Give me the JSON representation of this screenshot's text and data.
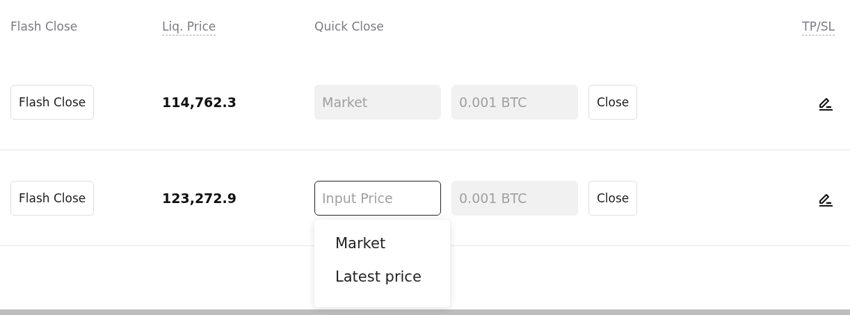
{
  "columns": [
    {
      "label": "Flash Close",
      "hint": false
    },
    {
      "label": "Liq. Price",
      "hint": true
    },
    {
      "label": "Quick Close",
      "hint": false
    },
    {
      "label": "TP/SL",
      "hint": true
    }
  ],
  "rows": [
    {
      "flash_close": "Flash Close",
      "liq_price": "114,762.3",
      "price_field": {
        "value": "Market",
        "disabled": true,
        "focused": false
      },
      "quantity_field": {
        "value": "0.001 BTC",
        "disabled": true
      },
      "close": "Close",
      "dropdown_open": false
    },
    {
      "flash_close": "Flash Close",
      "liq_price": "123,272.9",
      "price_field": {
        "placeholder": "Input Price",
        "disabled": false,
        "focused": true
      },
      "quantity_field": {
        "value": "0.001 BTC",
        "disabled": true
      },
      "close": "Close",
      "dropdown_open": true
    }
  ],
  "dropdown": {
    "options": [
      "Market",
      "Latest price"
    ]
  }
}
